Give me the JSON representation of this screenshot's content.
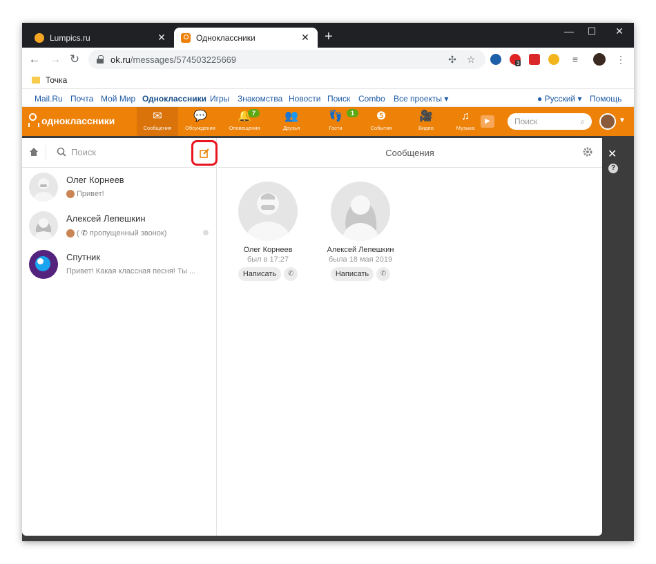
{
  "browser": {
    "tabs": [
      {
        "title": "Lumpics.ru",
        "favicon": "lumpics-favicon-icon"
      },
      {
        "title": "Одноклассники",
        "favicon": "ok-favicon-icon"
      }
    ],
    "url_host": "ok.ru",
    "url_path": "/messages/574503225669",
    "bookmarks": [
      {
        "label": "Точка"
      }
    ],
    "extension_badge": "3"
  },
  "site_links": {
    "left": [
      "Mail.Ru",
      "Почта",
      "Мой Мир",
      "Одноклассники",
      "Игры",
      "Знакомства",
      "Новости",
      "Поиск",
      "Combo",
      "Все проекты ▾"
    ],
    "active": "Одноклассники",
    "language": "Русский ▾",
    "help": "Помощь"
  },
  "ok_header": {
    "logo_text": "одноклассники",
    "nav": [
      {
        "label": "Сообщения",
        "icon": "envelope-icon",
        "active": true
      },
      {
        "label": "Обсуждения",
        "icon": "chat-bubbles-icon"
      },
      {
        "label": "Оповещения",
        "icon": "bell-icon",
        "badge": "7"
      },
      {
        "label": "Друзья",
        "icon": "friends-icon"
      },
      {
        "label": "Гости",
        "icon": "footprints-icon",
        "badge": "1"
      },
      {
        "label": "События",
        "icon": "events-icon"
      },
      {
        "label": "Видео",
        "icon": "video-icon"
      },
      {
        "label": "Музыка",
        "icon": "music-icon"
      }
    ],
    "search_placeholder": "Поиск",
    "accent_color": "#ee8208"
  },
  "messenger": {
    "search_placeholder": "Поиск",
    "title": "Сообщения",
    "chats": [
      {
        "name": "Олег Корнеев",
        "preview": "Привет!"
      },
      {
        "name": "Алексей Лепешкин",
        "preview": "пропущенный звонок)",
        "prefix": "("
      },
      {
        "name": "Спутник",
        "preview": "Привет! Какая классная песня! Ты ..."
      }
    ],
    "contacts": [
      {
        "name": "Олег Корнеев",
        "status": "был в 17:27",
        "write": "Написать"
      },
      {
        "name": "Алексей Лепешкин",
        "status": "была 18 мая 2019",
        "write": "Написать"
      }
    ]
  }
}
